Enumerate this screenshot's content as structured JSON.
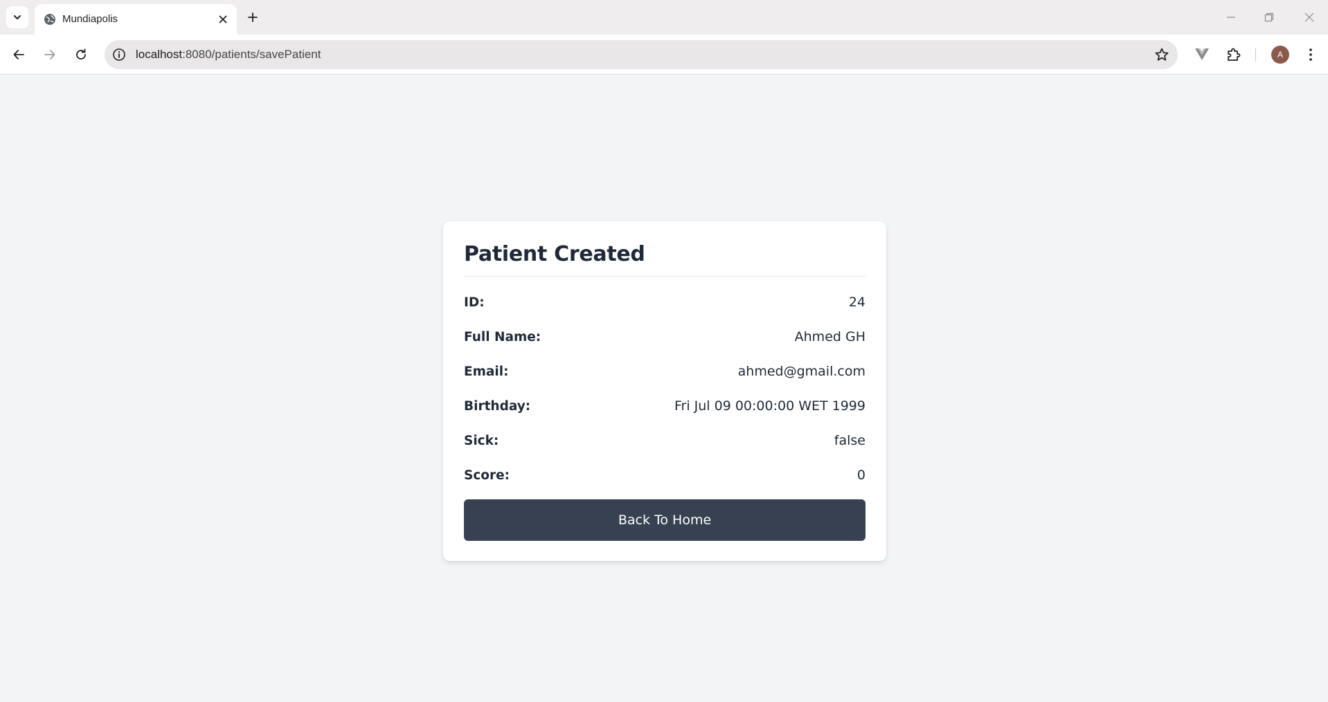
{
  "browser": {
    "tab_title": "Mundiapolis",
    "url_host": "localhost",
    "url_path": ":8080/patients/savePatient",
    "avatar_letter": "A",
    "icons": {
      "tab_search": "chevron-down-icon",
      "favicon": "globe-icon",
      "close": "close-icon",
      "new_tab": "plus-icon",
      "back": "arrow-left-icon",
      "forward": "arrow-right-icon",
      "reload": "reload-icon",
      "site_info": "info-icon",
      "bookmark": "star-icon",
      "extension_vue": "vue-icon",
      "extensions": "puzzle-icon",
      "menu": "kebab-icon"
    }
  },
  "card": {
    "title": "Patient Created",
    "fields": [
      {
        "label": "ID:",
        "value": "24"
      },
      {
        "label": "Full Name:",
        "value": "Ahmed GH"
      },
      {
        "label": "Email:",
        "value": "ahmed@gmail.com"
      },
      {
        "label": "Birthday:",
        "value": "Fri Jul 09 00:00:00 WET 1999"
      },
      {
        "label": "Sick:",
        "value": "false"
      },
      {
        "label": "Score:",
        "value": "0"
      }
    ],
    "button_label": "Back To Home"
  },
  "colors": {
    "page_bg": "#f3f4f6",
    "card_bg": "#ffffff",
    "button_bg": "#374151",
    "text": "#1f2937"
  }
}
